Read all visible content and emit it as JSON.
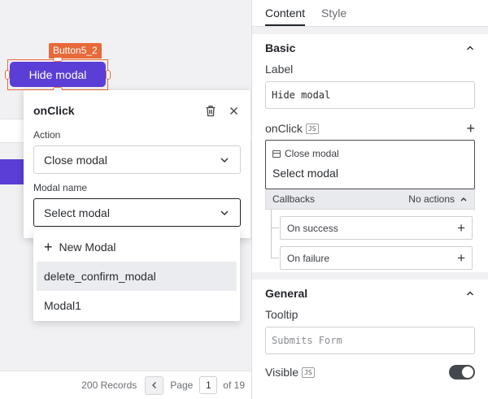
{
  "canvas": {
    "widget": {
      "name_tag": "Button5_2",
      "label": "Hide modal"
    },
    "footer": {
      "records": "200 Records",
      "page_label": "Page",
      "page_number": "1",
      "page_total": "of 19"
    }
  },
  "popover": {
    "title": "onClick",
    "delete_icon": "trash-icon",
    "close_icon": "close-icon",
    "action_label": "Action",
    "action_value": "Close modal",
    "modal_name_label": "Modal name",
    "modal_name_value": "Select modal",
    "dropdown": {
      "new_label": "New Modal",
      "options": [
        "delete_confirm_modal",
        "Modal1"
      ]
    }
  },
  "pane": {
    "tabs": [
      "Content",
      "Style"
    ],
    "basic": {
      "title": "Basic",
      "label_label": "Label",
      "label_value": "Hide modal",
      "onclick_label": "onClick",
      "js_badge": "JS",
      "action_name": "Close modal",
      "action_value": "Select modal",
      "callbacks_label": "Callbacks",
      "callbacks_status": "No actions",
      "on_success": "On success",
      "on_failure": "On failure"
    },
    "general": {
      "title": "General",
      "tooltip_label": "Tooltip",
      "tooltip_placeholder": "Submits Form",
      "visible_label": "Visible",
      "js_badge": "JS",
      "visible_on": true
    }
  },
  "colors": {
    "accent": "#5b3ed6",
    "selection": "#e8693a"
  }
}
